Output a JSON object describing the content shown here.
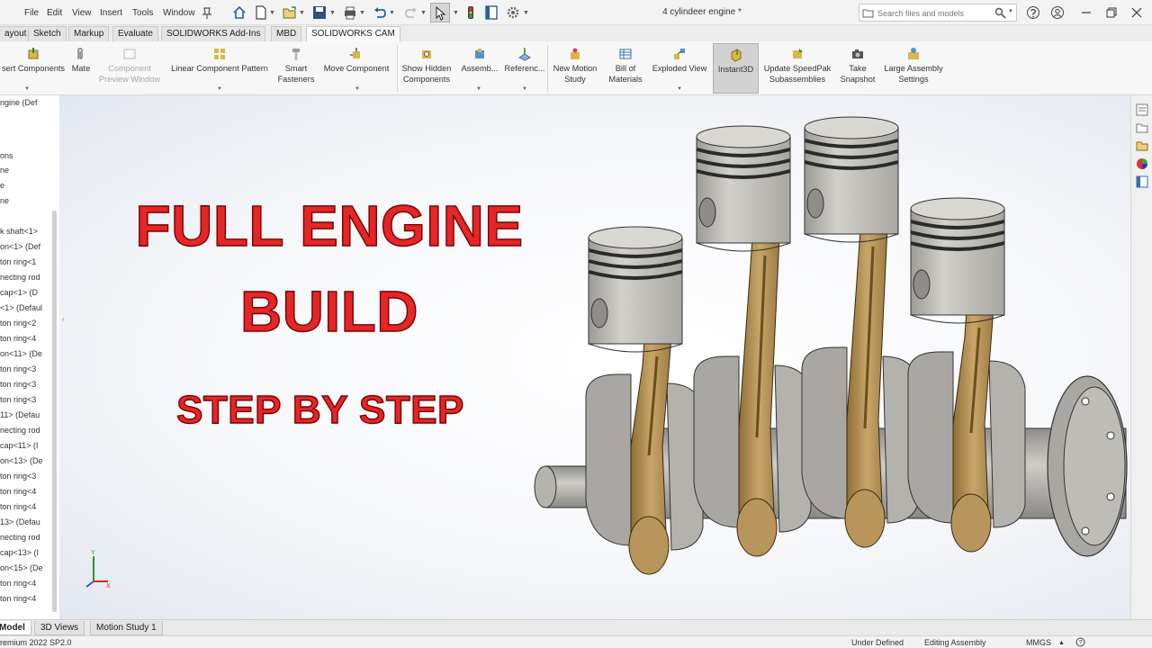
{
  "menu": [
    "File",
    "Edit",
    "View",
    "Insert",
    "Tools",
    "Window"
  ],
  "document_title": "4 cylindeer engine *",
  "search": {
    "placeholder": "Search files and models"
  },
  "tabs": [
    "ayout",
    "Sketch",
    "Markup",
    "Evaluate",
    "SOLIDWORKS Add-Ins",
    "MBD",
    "SOLIDWORKS CAM"
  ],
  "ribbon": {
    "insert_components": "sert Components",
    "mate": "Mate",
    "component_preview": "Component\nPreview Window",
    "linear_pattern": "Linear Component Pattern",
    "smart_fasteners": "Smart\nFasteners",
    "move_component": "Move Component",
    "show_hidden": "Show Hidden\nComponents",
    "assembly": "Assemb...",
    "reference": "Referenc...",
    "new_motion_study": "New Motion\nStudy",
    "bill_of_materials": "Bill of\nMaterials",
    "exploded_view": "Exploded View",
    "instant3d": "Instant3D",
    "update_speedpak": "Update SpeedPak\nSubassemblies",
    "take_snapshot": "Take\nSnapshot",
    "large_assembly": "Large Assembly\nSettings"
  },
  "tree_items": [
    "ngine (Def",
    "ons",
    "ne",
    "e",
    "ne",
    "k shaft<1>",
    "on<1> (Def",
    "ton ring<1",
    "necting rod",
    "cap<1> (D",
    "<1> (Defaul",
    "ton ring<2",
    "ton ring<4",
    "on<11> (De",
    "ton ring<3",
    "ton ring<3",
    "ton ring<3",
    "11> (Defau",
    "necting rod",
    "cap<11> (I",
    "on<13> (De",
    "ton ring<3",
    "ton ring<4",
    "ton ring<4",
    "13> (Defau",
    "necting rod",
    "cap<13> (I",
    "on<15> (De",
    "ton ring<4",
    "ton ring<4"
  ],
  "overlay": {
    "line1": "FULL ENGINE",
    "line2": "BUILD",
    "line3": "STEP BY STEP"
  },
  "triad": {
    "y": "Y",
    "x": "X"
  },
  "model_tabs": [
    "Model",
    "3D Views",
    "Motion Study 1"
  ],
  "status": {
    "version": "remium 2022 SP2.0",
    "state": "Under Defined",
    "mode": "Editing Assembly",
    "units": "MMGS"
  },
  "colors": {
    "overlay_text": "#e32626",
    "overlay_outline": "#7a0000",
    "piston": "#b9b7b2",
    "connecting_rod": "#b8955a",
    "crank": "#a9a7a3"
  }
}
